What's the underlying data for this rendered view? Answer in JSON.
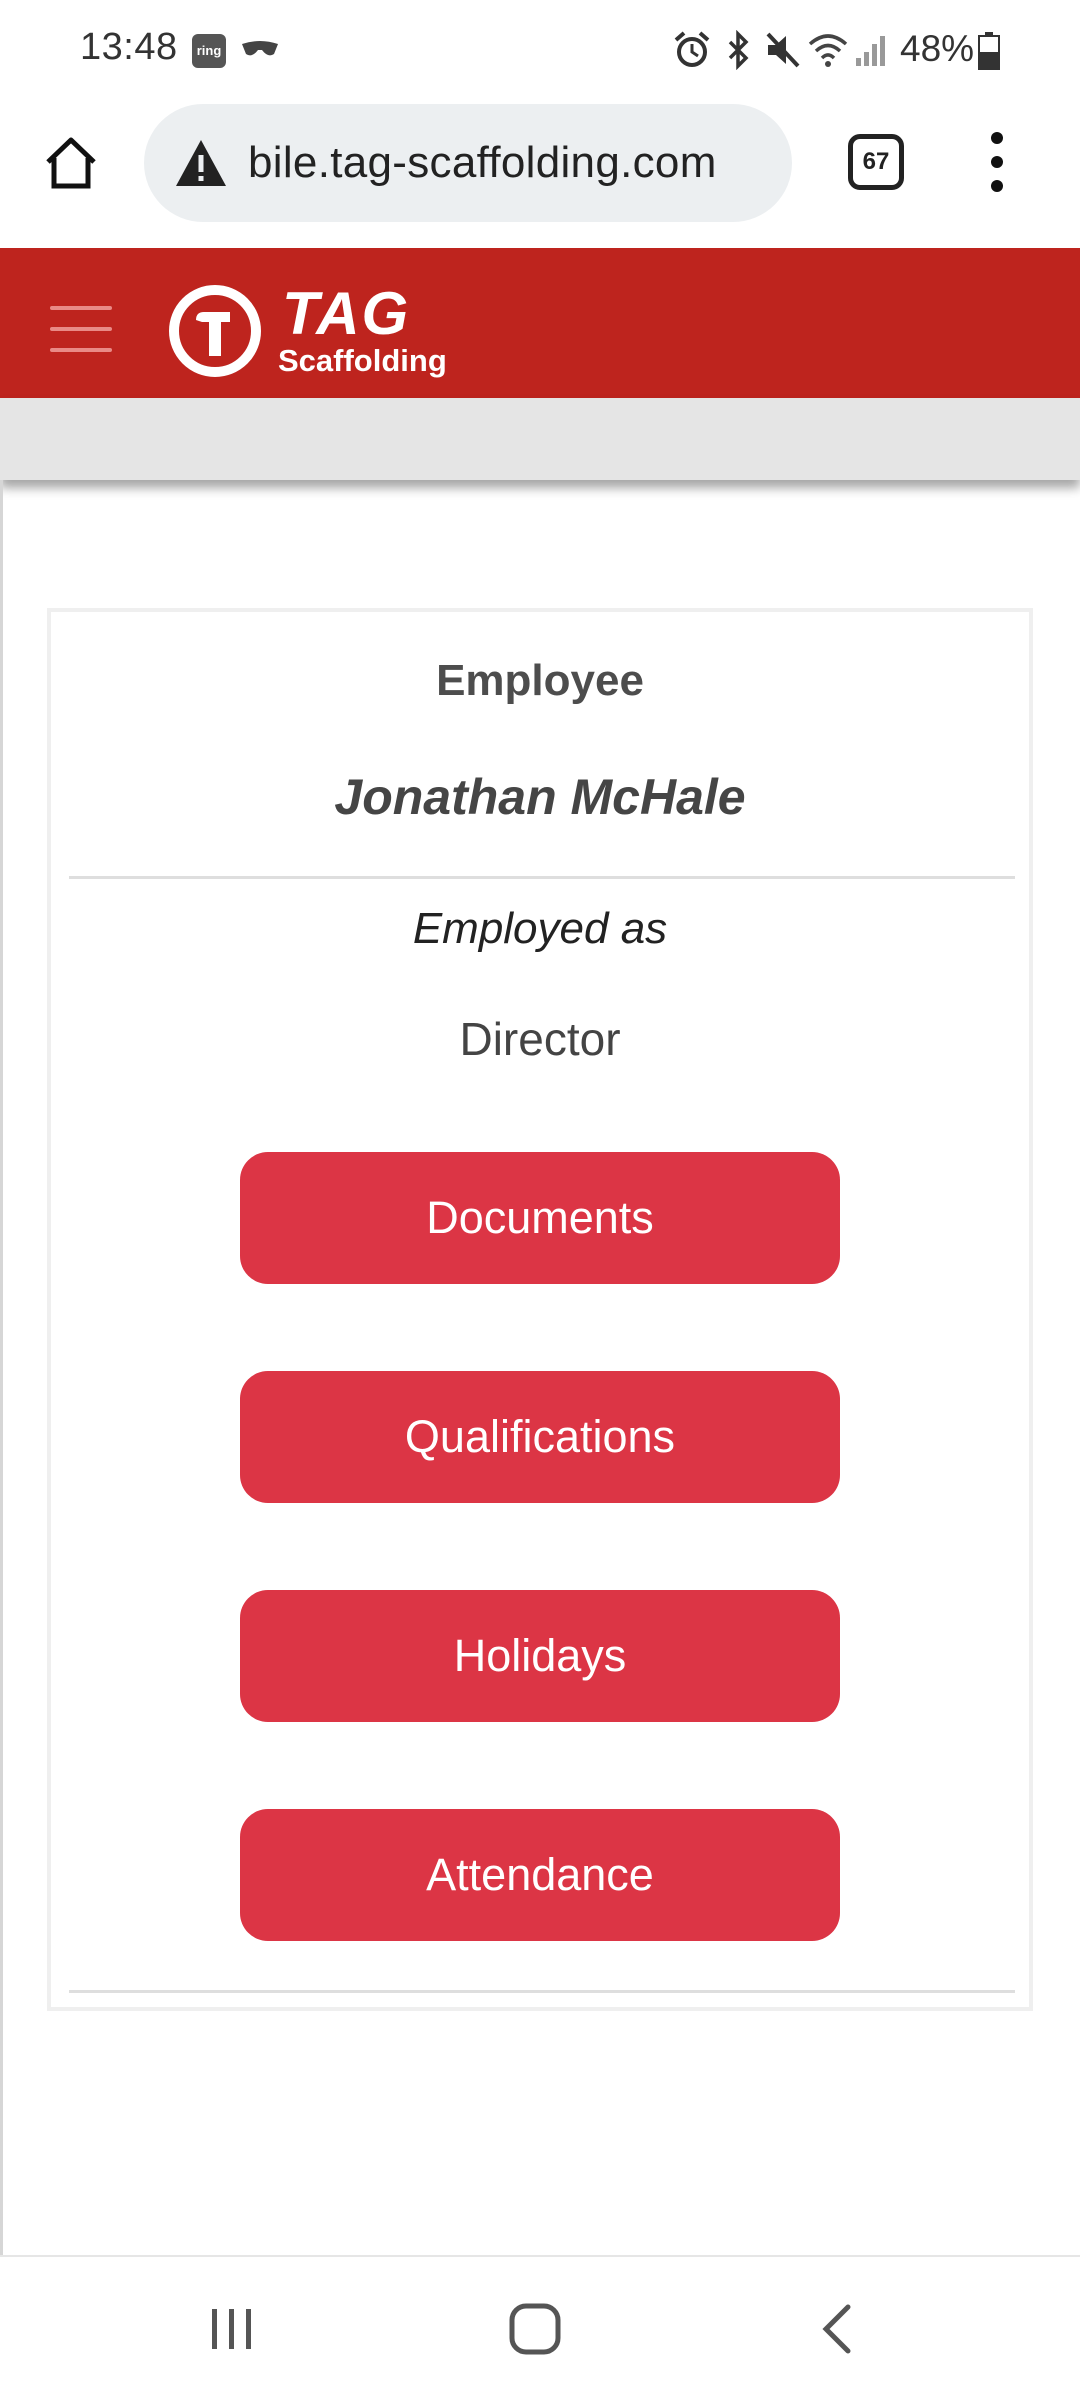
{
  "status_bar": {
    "time": "13:48",
    "ring_badge": "ring",
    "battery": "48%"
  },
  "browser": {
    "url": "bile.tag-scaffolding.com",
    "tab_count": "67"
  },
  "app": {
    "logo_word": "TAG",
    "logo_sub": "Scaffolding",
    "brand_color": "#be241e"
  },
  "employee_card": {
    "title": "Employee",
    "name": "Jonathan McHale",
    "employed_as_label": "Employed as",
    "role": "Director",
    "buttons": [
      {
        "label": "Documents"
      },
      {
        "label": "Qualifications"
      },
      {
        "label": "Holidays"
      },
      {
        "label": "Attendance"
      }
    ],
    "button_color": "#dc3545"
  },
  "icons": {
    "status": [
      "ring-icon",
      "glasses-icon",
      "alarm-icon",
      "bluetooth-icon",
      "mute-icon",
      "wifi-icon",
      "signal-icon",
      "battery-icon"
    ],
    "browser": [
      "home-icon",
      "warning-icon",
      "tabs-icon",
      "more-vert-icon"
    ],
    "nav": [
      "recents-icon",
      "home-icon",
      "back-icon"
    ]
  }
}
